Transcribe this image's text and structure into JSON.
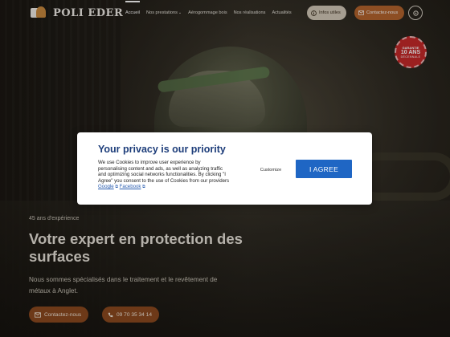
{
  "header": {
    "logo_text": "POLI EDER",
    "nav": [
      {
        "label": "Accueil",
        "active": true
      },
      {
        "label": "Nos prestations",
        "has_menu": true
      },
      {
        "label": "Aérogommage bois"
      },
      {
        "label": "Nos réalisations"
      },
      {
        "label": "Actualités"
      }
    ],
    "info_button": "Infos utiles",
    "contact_button": "Contactez-nous"
  },
  "badge": {
    "line1": "GARANTIE",
    "line2": "10 ANS",
    "line3": "DÉCENNALE"
  },
  "hero": {
    "kicker": "45 ans d'expérience",
    "title": "Votre expert en protection des surfaces",
    "text": "Nous sommes spécialisés dans le traitement et le revêtement de métaux à Anglet.",
    "contact_button": "Contactez-nous",
    "phone_button": "09 70 35 34 14"
  },
  "cookie": {
    "title": "Your privacy is our priority",
    "text_before": "We use Cookies to improve user experience by personalising content and ads, as well as analyzing traffic and optimizing social networks functionalities. By clicking \"I Agree\" you consent to the use of Cookies from our providers",
    "link_google": "Google",
    "link_facebook": "Facebook",
    "customize_label": "Customize",
    "agree_label": "I AGREE"
  },
  "colors": {
    "accent_brown": "#b5652d",
    "cookie_title": "#1d3d7a",
    "agree_blue": "#1f66c4",
    "badge_red": "#c72a2a"
  },
  "icons": [
    "info-icon",
    "mail-icon",
    "settings-icon",
    "phone-icon",
    "external-link-icon"
  ]
}
